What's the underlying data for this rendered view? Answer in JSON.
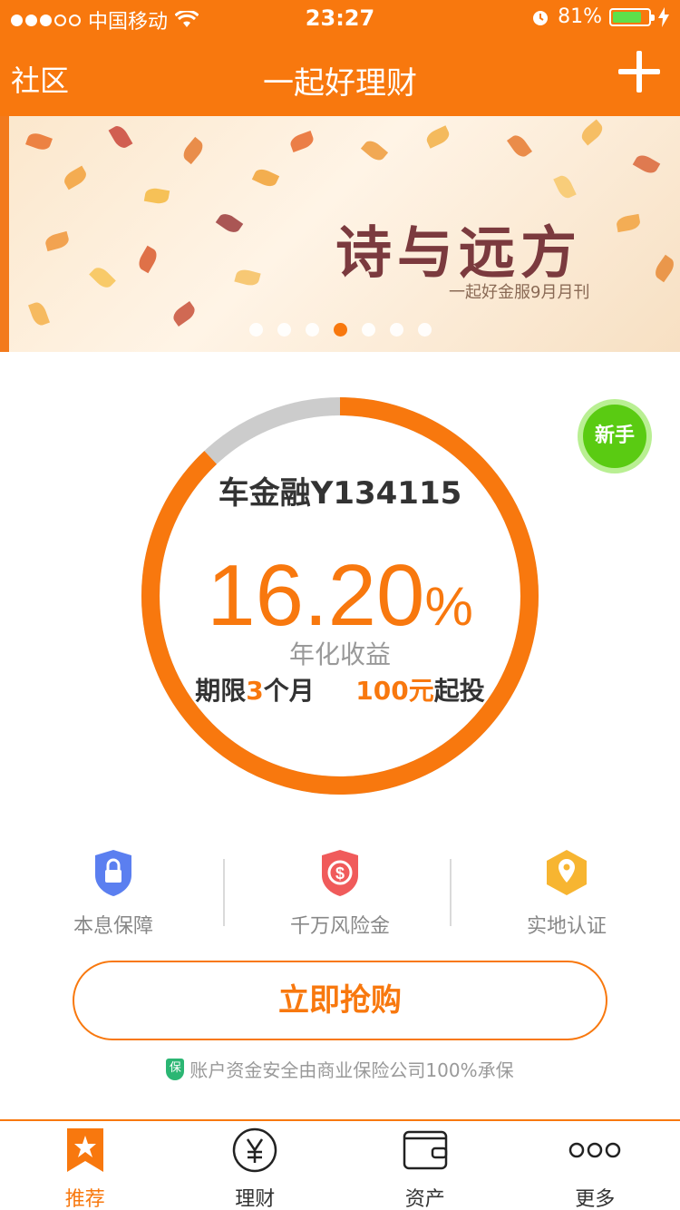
{
  "status_bar": {
    "carrier": "中国移动",
    "time": "23:27",
    "battery": "81%",
    "battery_level": 0.81,
    "signal_bars": 3
  },
  "nav": {
    "left_label": "社区",
    "title": "一起好理财",
    "right_icon": "plus-icon"
  },
  "banner": {
    "headline": "诗与远方",
    "subtitle": "一起好金服9月月刊",
    "pages": 7,
    "active_page": 4
  },
  "product": {
    "badge": "新手",
    "name": "车金融Y134115",
    "rate_number": "16.20",
    "rate_unit": "%",
    "rate_label": "年化收益",
    "term_prefix": "期限",
    "term_value": "3",
    "term_suffix": "个月",
    "min_value": "100元",
    "min_suffix": "起投",
    "progress": 0.88
  },
  "features": [
    {
      "label": "本息保障",
      "icon": "shield-lock-icon"
    },
    {
      "label": "千万风险金",
      "icon": "shield-dollar-icon"
    },
    {
      "label": "实地认证",
      "icon": "location-pin-icon"
    }
  ],
  "buy_button": "立即抢购",
  "insurance_note": {
    "badge": "保",
    "text": "账户资金安全由商业保险公司100%承保"
  },
  "tabs": [
    {
      "label": "推荐",
      "icon": "star-bookmark-icon",
      "active": true
    },
    {
      "label": "理财",
      "icon": "yen-icon",
      "active": false
    },
    {
      "label": "资产",
      "icon": "wallet-icon",
      "active": false
    },
    {
      "label": "更多",
      "icon": "more-dots-icon",
      "active": false
    }
  ],
  "colors": {
    "brand": "#f8780e",
    "badge_green": "#5acb12",
    "ring_track": "#cccccc"
  }
}
